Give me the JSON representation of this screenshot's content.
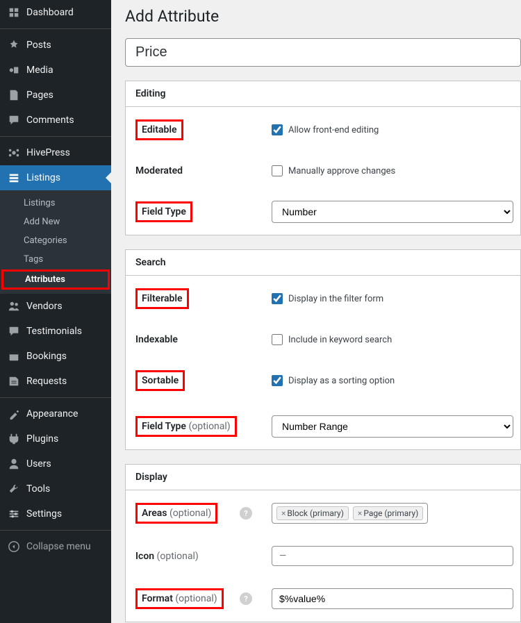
{
  "sidebar": {
    "items": [
      {
        "label": "Dashboard",
        "icon": "dashboard"
      },
      {
        "label": "Posts",
        "icon": "pin"
      },
      {
        "label": "Media",
        "icon": "media"
      },
      {
        "label": "Pages",
        "icon": "pages"
      },
      {
        "label": "Comments",
        "icon": "comments"
      },
      {
        "label": "HivePress",
        "icon": "hivepress"
      },
      {
        "label": "Listings",
        "icon": "listings",
        "current": true
      },
      {
        "label": "Vendors",
        "icon": "vendors"
      },
      {
        "label": "Testimonials",
        "icon": "testimonials"
      },
      {
        "label": "Bookings",
        "icon": "bookings"
      },
      {
        "label": "Requests",
        "icon": "requests"
      },
      {
        "label": "Appearance",
        "icon": "appearance"
      },
      {
        "label": "Plugins",
        "icon": "plugins"
      },
      {
        "label": "Users",
        "icon": "users"
      },
      {
        "label": "Tools",
        "icon": "tools"
      },
      {
        "label": "Settings",
        "icon": "settings"
      },
      {
        "label": "Collapse menu",
        "icon": "collapse"
      }
    ],
    "submenu": [
      {
        "label": "Listings"
      },
      {
        "label": "Add New"
      },
      {
        "label": "Categories"
      },
      {
        "label": "Tags"
      },
      {
        "label": "Attributes",
        "current": true,
        "highlighted": true
      }
    ]
  },
  "page": {
    "title": "Add Attribute",
    "name_input": "Price"
  },
  "editing": {
    "heading": "Editing",
    "editable_label": "Editable",
    "editable_checked": true,
    "editable_text": "Allow front-end editing",
    "moderated_label": "Moderated",
    "moderated_checked": false,
    "moderated_text": "Manually approve changes",
    "fieldtype_label": "Field Type",
    "fieldtype_value": "Number"
  },
  "search": {
    "heading": "Search",
    "filterable_label": "Filterable",
    "filterable_checked": true,
    "filterable_text": "Display in the filter form",
    "indexable_label": "Indexable",
    "indexable_checked": false,
    "indexable_text": "Include in keyword search",
    "sortable_label": "Sortable",
    "sortable_checked": true,
    "sortable_text": "Display as a sorting option",
    "fieldtype_label": "Field Type",
    "fieldtype_optional": " (optional)",
    "fieldtype_value": "Number Range"
  },
  "display": {
    "heading": "Display",
    "areas_label": "Areas",
    "areas_optional": " (optional)",
    "areas_tags": [
      "Block (primary)",
      "Page (primary)"
    ],
    "icon_label": "Icon",
    "icon_optional": " (optional)",
    "icon_value": "—",
    "format_label": "Format",
    "format_optional": " (optional)",
    "format_value": "$%value%"
  }
}
